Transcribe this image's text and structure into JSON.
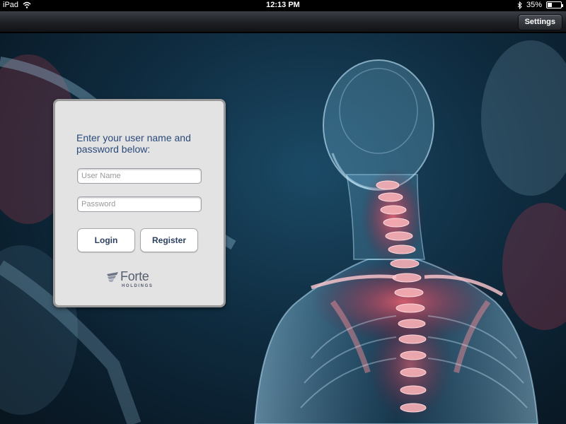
{
  "status_bar": {
    "device": "iPad",
    "time": "12:13 PM",
    "battery_percent": "35%",
    "battery_level": 0.35
  },
  "nav_bar": {
    "settings_label": "Settings"
  },
  "login": {
    "prompt": "Enter your user name and password below:",
    "username_placeholder": "User Name",
    "password_placeholder": "Password",
    "login_label": "Login",
    "register_label": "Register"
  },
  "logo": {
    "name": "Forte",
    "subtitle": "HOLDINGS"
  },
  "colors": {
    "prompt_text": "#2a4a7a",
    "panel_bg": "#e3e3e3",
    "spine_highlight": "#e0505a"
  }
}
